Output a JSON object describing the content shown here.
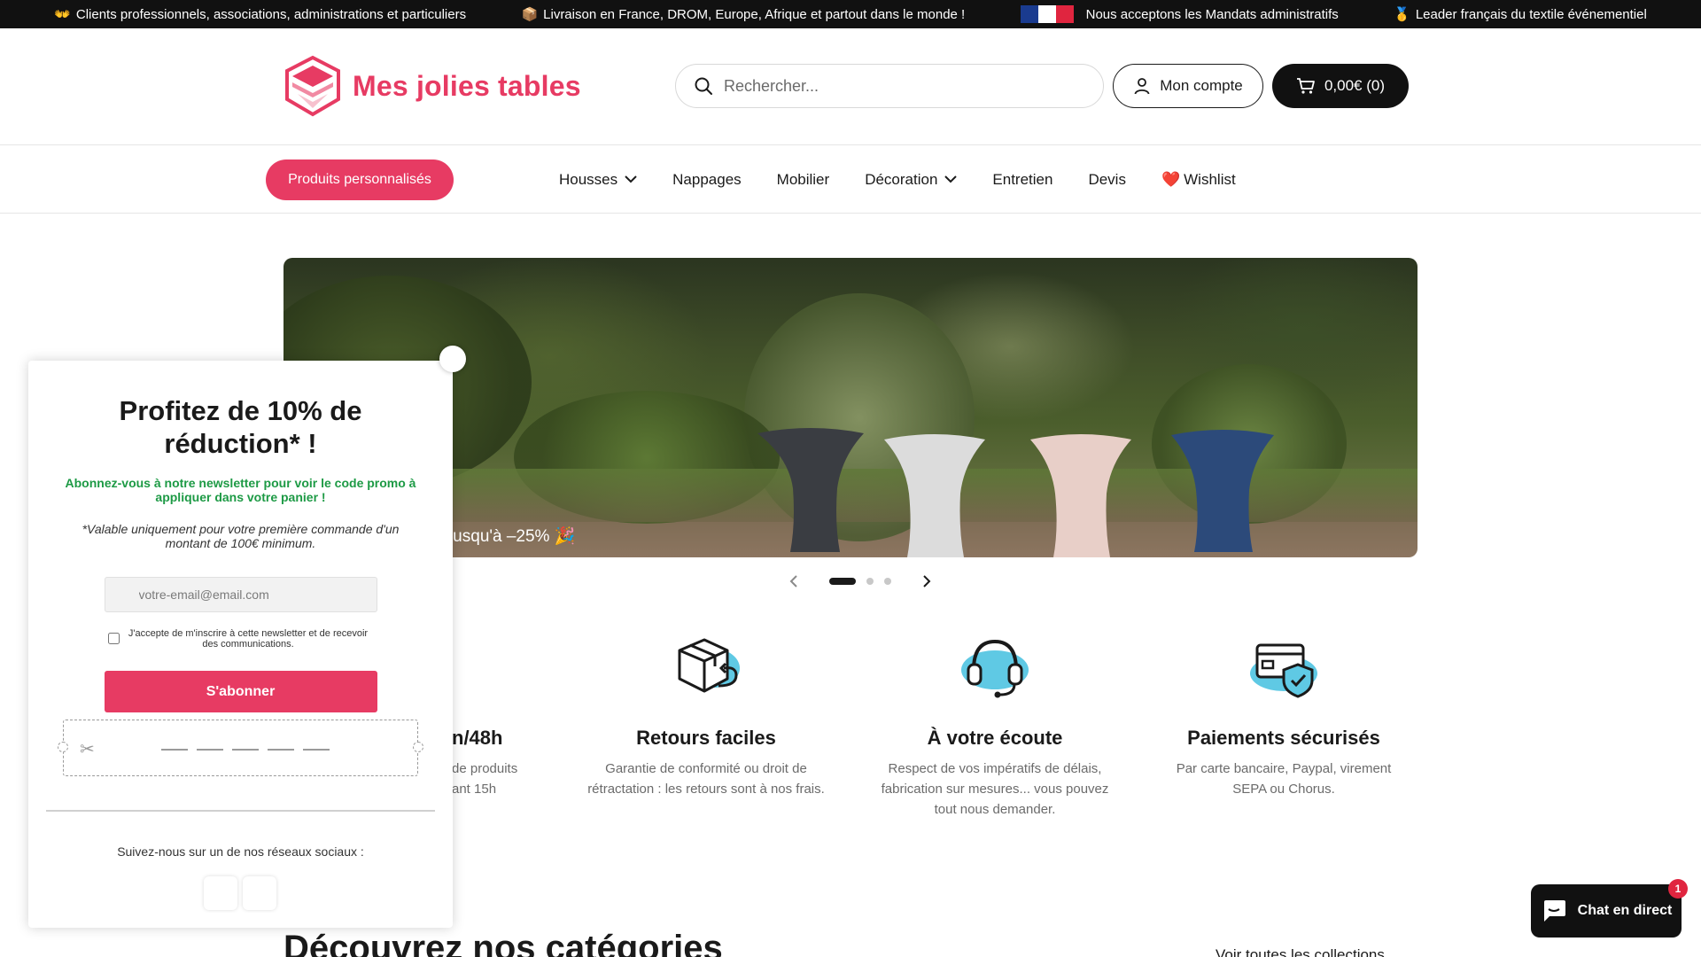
{
  "announcements": [
    {
      "emoji": "👐",
      "text": "Clients professionnels, associations, administrations et particuliers"
    },
    {
      "emoji": "📦",
      "text": "Livraison en France, DROM, Europe, Afrique et partout dans le monde !"
    },
    {
      "emoji": "",
      "text": "Nous acceptons les Mandats administratifs"
    },
    {
      "emoji": "🥇",
      "text": "Leader français du textile événementiel"
    }
  ],
  "flag_colors": [
    "#1a3b8f",
    "#ffffff",
    "#e0253f"
  ],
  "brand": {
    "name": "Mes jolies tables",
    "accent": "#e73b63"
  },
  "search": {
    "placeholder": "Rechercher..."
  },
  "account": {
    "label": "Mon compte"
  },
  "cart": {
    "label": "0,00€ (0)"
  },
  "nav": {
    "cta": "Produits personnalisés",
    "items": [
      "Housses",
      "Nappages",
      "Mobilier",
      "Décoration",
      "Entretien",
      "Devis",
      "Wishlist"
    ],
    "wishlist_emoji": "❤️"
  },
  "hero": {
    "caption": "e // Jusqu'à –25% 🎉"
  },
  "slider": {
    "slides": 3,
    "active": 1
  },
  "features": [
    {
      "icon": "box-return-icon",
      "title": "n/48h",
      "text": "de produits\nant 15h"
    },
    {
      "icon": "box-return-icon",
      "title": "Retours faciles",
      "text": "Garantie de conformité ou droit de rétractation : les retours sont à nos frais."
    },
    {
      "icon": "headset-icon",
      "title": "À votre écoute",
      "text": "Respect de vos impératifs de délais, fabrication sur mesures... vous pouvez tout nous demander."
    },
    {
      "icon": "secure-card-icon",
      "title": "Paiements sécurisés",
      "text": "Par carte bancaire, Paypal, virement SEPA ou Chorus."
    }
  ],
  "categories": {
    "heading": "Découvrez nos catégories",
    "see_all": "Voir toutes les collections"
  },
  "popup": {
    "title": "Profitez de 10% de réduction* !",
    "pitch": "Abonnez-vous à notre newsletter pour voir le code promo à appliquer dans votre panier !",
    "condition": "*Valable uniquement pour votre première commande d'un montant de 100€ minimum.",
    "email_placeholder": "votre-email@email.com",
    "consent": "J'accepte de m'inscrire à cette newsletter et de recevoir des communications.",
    "subscribe": "S'abonner",
    "follow": "Suivez-nous sur un de nos réseaux sociaux :"
  },
  "chat": {
    "label": "Chat en direct",
    "badge": "1"
  }
}
